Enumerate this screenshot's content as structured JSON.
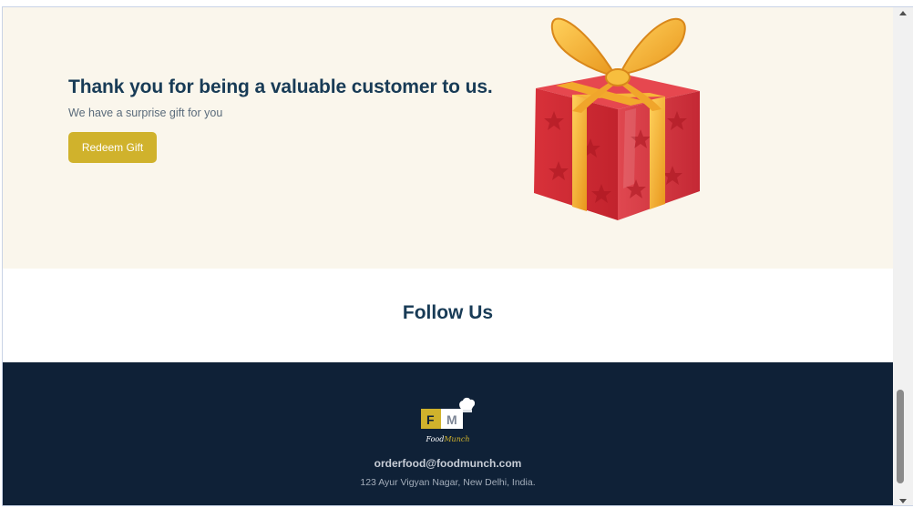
{
  "gift_section": {
    "title": "Thank you for being a valuable customer to us.",
    "subtitle": "We have a surprise gift for you",
    "redeem_button_label": "Redeem Gift",
    "image_name": "gift-box-icon"
  },
  "follow": {
    "title": "Follow Us"
  },
  "footer": {
    "logo_letters": [
      "F",
      "M"
    ],
    "logo_text_food": "Food",
    "logo_text_munch": "Munch",
    "email": "orderfood@foodmunch.com",
    "address": "123 Ayur Vigyan Nagar, New Delhi, India."
  },
  "colors": {
    "gift_bg": "#faf6ec",
    "heading": "#183b56",
    "accent": "#d0b22c",
    "footer_bg": "#0f2137"
  },
  "scrollbar": {
    "position_fraction": 0.82
  }
}
